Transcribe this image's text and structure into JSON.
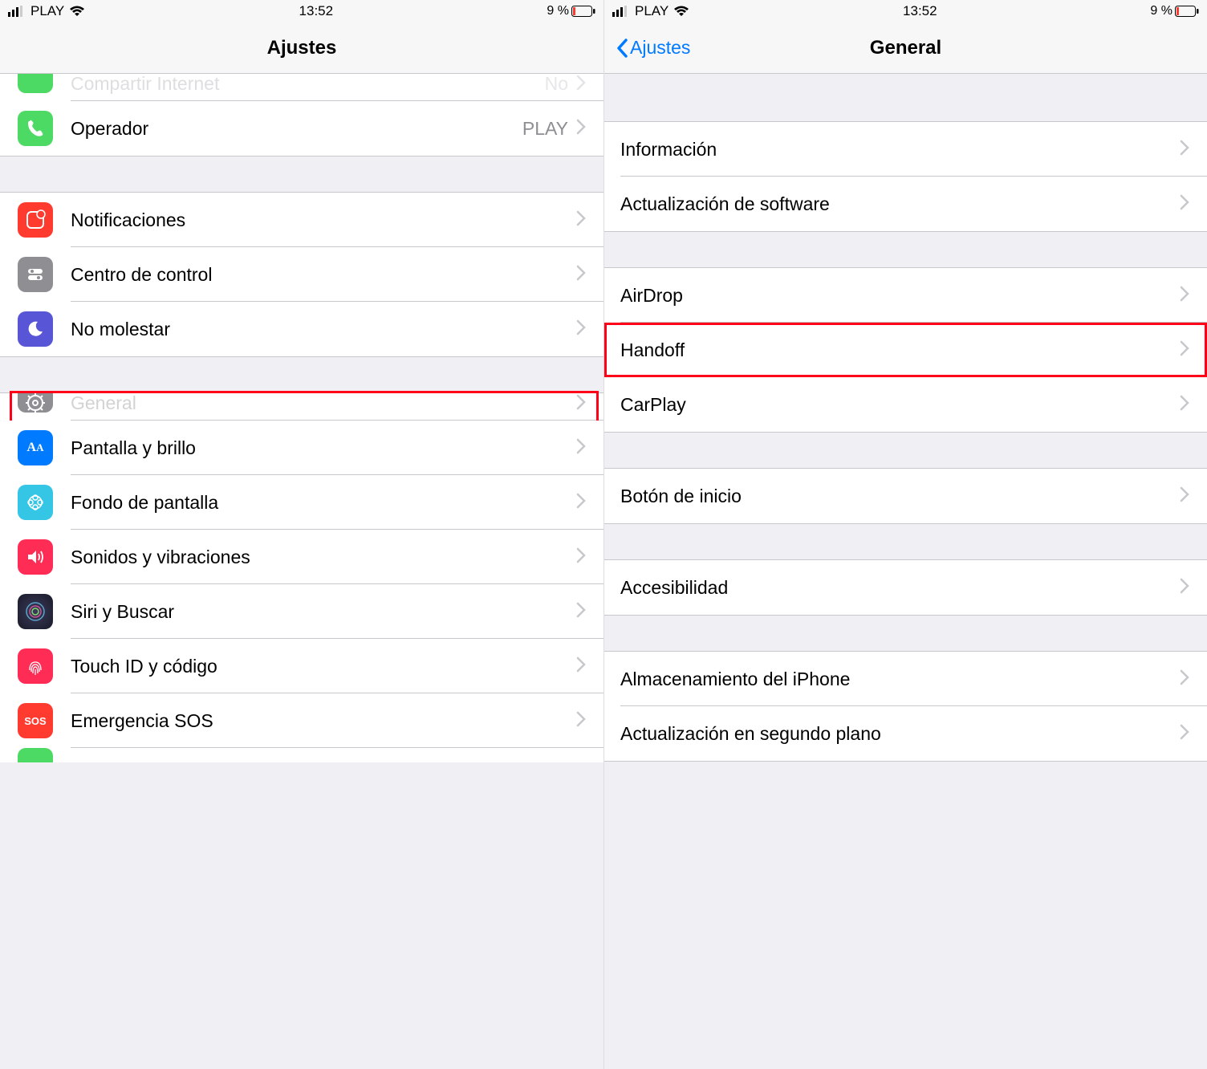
{
  "status": {
    "carrier": "PLAY",
    "time": "13:52",
    "battery_text": "9 %"
  },
  "left": {
    "title": "Ajustes",
    "rows": [
      {
        "label": "Compartir Internet",
        "detail": "No"
      },
      {
        "label": "Operador",
        "detail": "PLAY"
      },
      {
        "label": "Notificaciones"
      },
      {
        "label": "Centro de control"
      },
      {
        "label": "No molestar"
      },
      {
        "label": "General"
      },
      {
        "label": "Pantalla y brillo"
      },
      {
        "label": "Fondo de pantalla"
      },
      {
        "label": "Sonidos y vibraciones"
      },
      {
        "label": "Siri y Buscar"
      },
      {
        "label": "Touch ID y código"
      },
      {
        "label": "Emergencia SOS"
      }
    ]
  },
  "right": {
    "back": "Ajustes",
    "title": "General",
    "rows": [
      {
        "label": "Información"
      },
      {
        "label": "Actualización de software"
      },
      {
        "label": "AirDrop"
      },
      {
        "label": "Handoff"
      },
      {
        "label": "CarPlay"
      },
      {
        "label": "Botón de inicio"
      },
      {
        "label": "Accesibilidad"
      },
      {
        "label": "Almacenamiento del iPhone"
      },
      {
        "label": "Actualización en segundo plano"
      }
    ]
  }
}
